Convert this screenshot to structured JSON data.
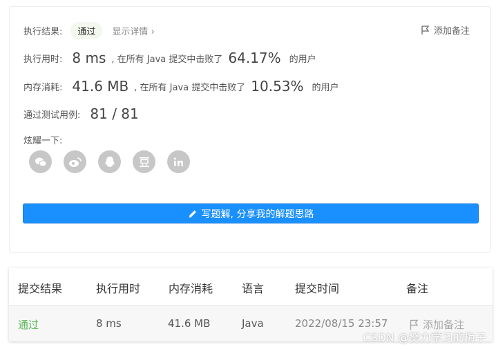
{
  "result": {
    "label": "执行结果:",
    "status": "通过",
    "details_link": "显示详情",
    "details_chevron": "›",
    "add_note": "添加备注"
  },
  "runtime": {
    "label": "执行用时:",
    "value": "8 ms",
    "beat_prefix": ", 在所有 Java 提交中击败了",
    "percent": "64.17%",
    "beat_suffix": "的用户"
  },
  "memory": {
    "label": "内存消耗:",
    "value": "41.6 MB",
    "beat_prefix": ", 在所有 Java 提交中击败了",
    "percent": "10.53%",
    "beat_suffix": "的用户"
  },
  "tests": {
    "label": "通过测试用例:",
    "value": "81 / 81"
  },
  "share": {
    "label": "炫耀一下:",
    "icons": [
      "wechat-icon",
      "weibo-icon",
      "qq-icon",
      "douban-icon",
      "linkedin-icon"
    ],
    "button_label": "写题解, 分享我的解题思路"
  },
  "table": {
    "headers": [
      "提交结果",
      "执行用时",
      "内存消耗",
      "语言",
      "提交时间",
      "备注"
    ],
    "rows": [
      {
        "result": "通过",
        "runtime": "8 ms",
        "memory": "41.6 MB",
        "language": "Java",
        "time": "2022/08/15 23:57",
        "note": "添加备注"
      }
    ]
  },
  "watermark": "CSDN @努力学习的梅子",
  "colors": {
    "accent": "#1a90ff",
    "success": "#5cb85c",
    "icon_gray": "#c7c7c7"
  }
}
